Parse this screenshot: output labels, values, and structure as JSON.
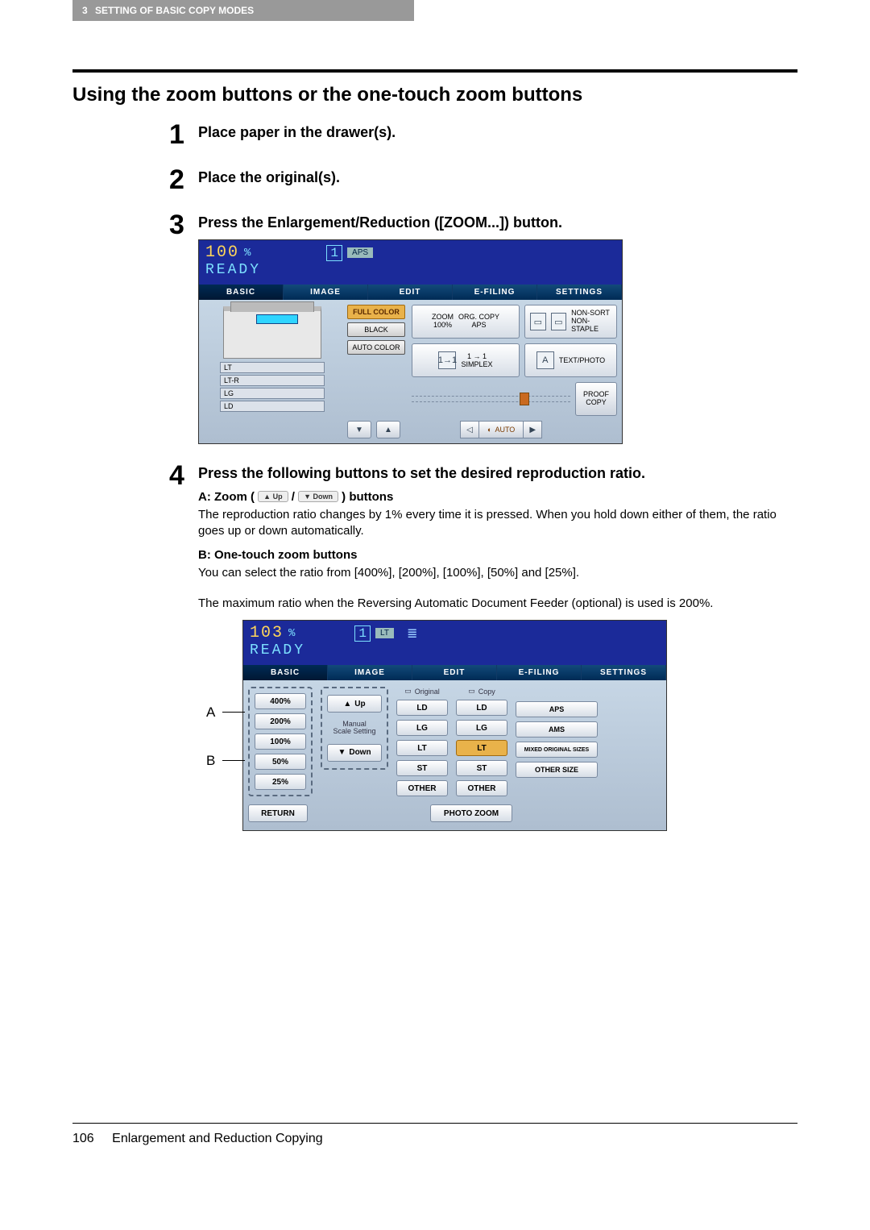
{
  "header": {
    "chapter": "3",
    "title": "SETTING OF BASIC COPY MODES"
  },
  "heading": "Using the zoom buttons or the one-touch zoom buttons",
  "steps": {
    "s1": {
      "num": "1",
      "title": "Place paper in the drawer(s)."
    },
    "s2": {
      "num": "2",
      "title": "Place the original(s)."
    },
    "s3": {
      "num": "3",
      "title": "Press the Enlargement/Reduction ([ZOOM...]) button."
    },
    "s4": {
      "num": "4",
      "title": "Press the following buttons to set the desired reproduction ratio.",
      "a_label": "A: Zoom (",
      "a_up": "▲ Up",
      "a_sep": " / ",
      "a_down": "▼ Down",
      "a_close": " ) buttons",
      "a_body": "The reproduction ratio changes by 1% every time it is pressed. When you hold down either of them, the ratio goes up or down automatically.",
      "b_label": "B: One-touch zoom buttons",
      "b_body": "You can select the ratio from [400%], [200%], [100%], [50%] and [25%].",
      "note": "The maximum ratio when the Reversing Automatic Document Feeder (optional) is used is 200%."
    }
  },
  "panel1": {
    "ratio": "100",
    "pct": "%",
    "count": "1",
    "aps": "APS",
    "ready": "READY",
    "tabs": [
      "BASIC",
      "IMAGE",
      "EDIT",
      "E-FILING",
      "SETTINGS"
    ],
    "drawers": [
      "LT",
      "LT-R",
      "LG",
      "LD"
    ],
    "color": {
      "full": "FULL COLOR",
      "black": "BLACK",
      "auto": "AUTO COLOR"
    },
    "zoom_btn": {
      "l1": "ZOOM",
      "l2": "100%"
    },
    "orig_btn": {
      "l1": "ORG.  COPY",
      "l2": "APS"
    },
    "sort_btn": {
      "l1": "NON-SORT",
      "l2": "NON-STAPLE"
    },
    "simplex": "1 → 1\nSIMPLEX",
    "textphoto": "TEXT/PHOTO",
    "auto": "AUTO",
    "proof": {
      "l1": "PROOF",
      "l2": "COPY"
    }
  },
  "panel2": {
    "ratio": "103",
    "pct": "%",
    "count": "1",
    "paper": "LT",
    "ready": "READY",
    "tabs": [
      "BASIC",
      "IMAGE",
      "EDIT",
      "E-FILING",
      "SETTINGS"
    ],
    "zoom_levels": [
      "400%",
      "200%",
      "100%",
      "50%",
      "25%"
    ],
    "up": "Up",
    "down": "Down",
    "manual": "Manual\nScale Setting",
    "orig_hdr": "Original",
    "copy_hdr": "Copy",
    "sizes": [
      "LD",
      "LG",
      "LT",
      "ST",
      "OTHER"
    ],
    "opts": [
      "APS",
      "AMS",
      "MIXED ORIGINAL SIZES",
      "OTHER SIZE"
    ],
    "return": "RETURN",
    "photo": "PHOTO ZOOM",
    "callout_a": "A",
    "callout_b": "B"
  },
  "footer": {
    "page": "106",
    "section": "Enlargement and Reduction Copying"
  }
}
